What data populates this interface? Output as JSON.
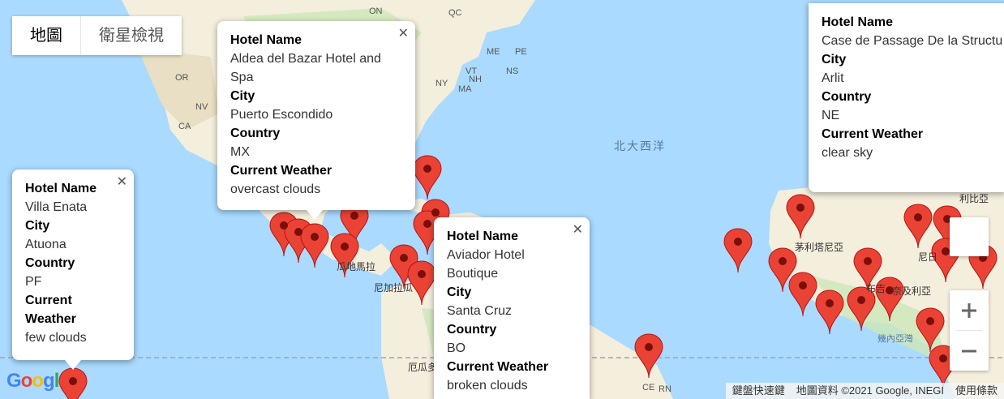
{
  "map_type": {
    "map": "地圖",
    "satellite": "衛星檢視"
  },
  "labels": {
    "on": "ON",
    "qc": "QC",
    "me": "ME",
    "vt": "VT",
    "nh": "NH",
    "ma": "MA",
    "ny": "NY",
    "pe": "PE",
    "ns": "NS",
    "or": "OR",
    "nv": "NV",
    "ca": "CA",
    "ocean": "北大西洋",
    "nicaragua": "尼加拉瓜",
    "guatemala": "瓜地馬拉",
    "libya": "利比亞",
    "nigeria": "奈及利亞",
    "niger": "尼日",
    "mauritania": "茅利塔尼亞",
    "guinea_gulf": "幾內亞灣",
    "burkina": "布吉",
    "ecuador": "厄瓜多",
    "ce": "CE",
    "rn": "RN"
  },
  "infowindows": [
    {
      "hotel_label": "Hotel Name",
      "hotel": "Aldea del Bazar Hotel and Spa",
      "city_label": "City",
      "city": "Puerto Escondido",
      "country_label": "Country",
      "country": "MX",
      "weather_label": "Current Weather",
      "weather": "overcast clouds"
    },
    {
      "hotel_label": "Hotel Name",
      "hotel": "Villa Enata",
      "city_label": "City",
      "city": "Atuona",
      "country_label": "Country",
      "country": "PF",
      "weather_label": "Current Weather",
      "weather": "few clouds"
    },
    {
      "hotel_label": "Hotel Name",
      "hotel": "Aviador Hotel Boutique",
      "city_label": "City",
      "city": "Santa Cruz",
      "country_label": "Country",
      "country": "BO",
      "weather_label": "Current Weather",
      "weather": "broken clouds"
    },
    {
      "hotel_label": "Hotel Name",
      "hotel": "Case de Passage De la Structu",
      "city_label": "City",
      "city": "Arlit",
      "country_label": "Country",
      "country": "NE",
      "weather_label": "Current Weather",
      "weather": "clear sky"
    }
  ],
  "attribution": {
    "shortcuts": "鍵盤快速鍵",
    "data": "地圖資料 ©2021 Google, INEGI",
    "terms": "使用條款"
  },
  "google_logo": "Google",
  "colors": {
    "water": "#aadaff",
    "land": "#f4eedd",
    "green": "#cde7b9",
    "marker": "#ea4335",
    "marker_dot": "#7a0f0a"
  }
}
